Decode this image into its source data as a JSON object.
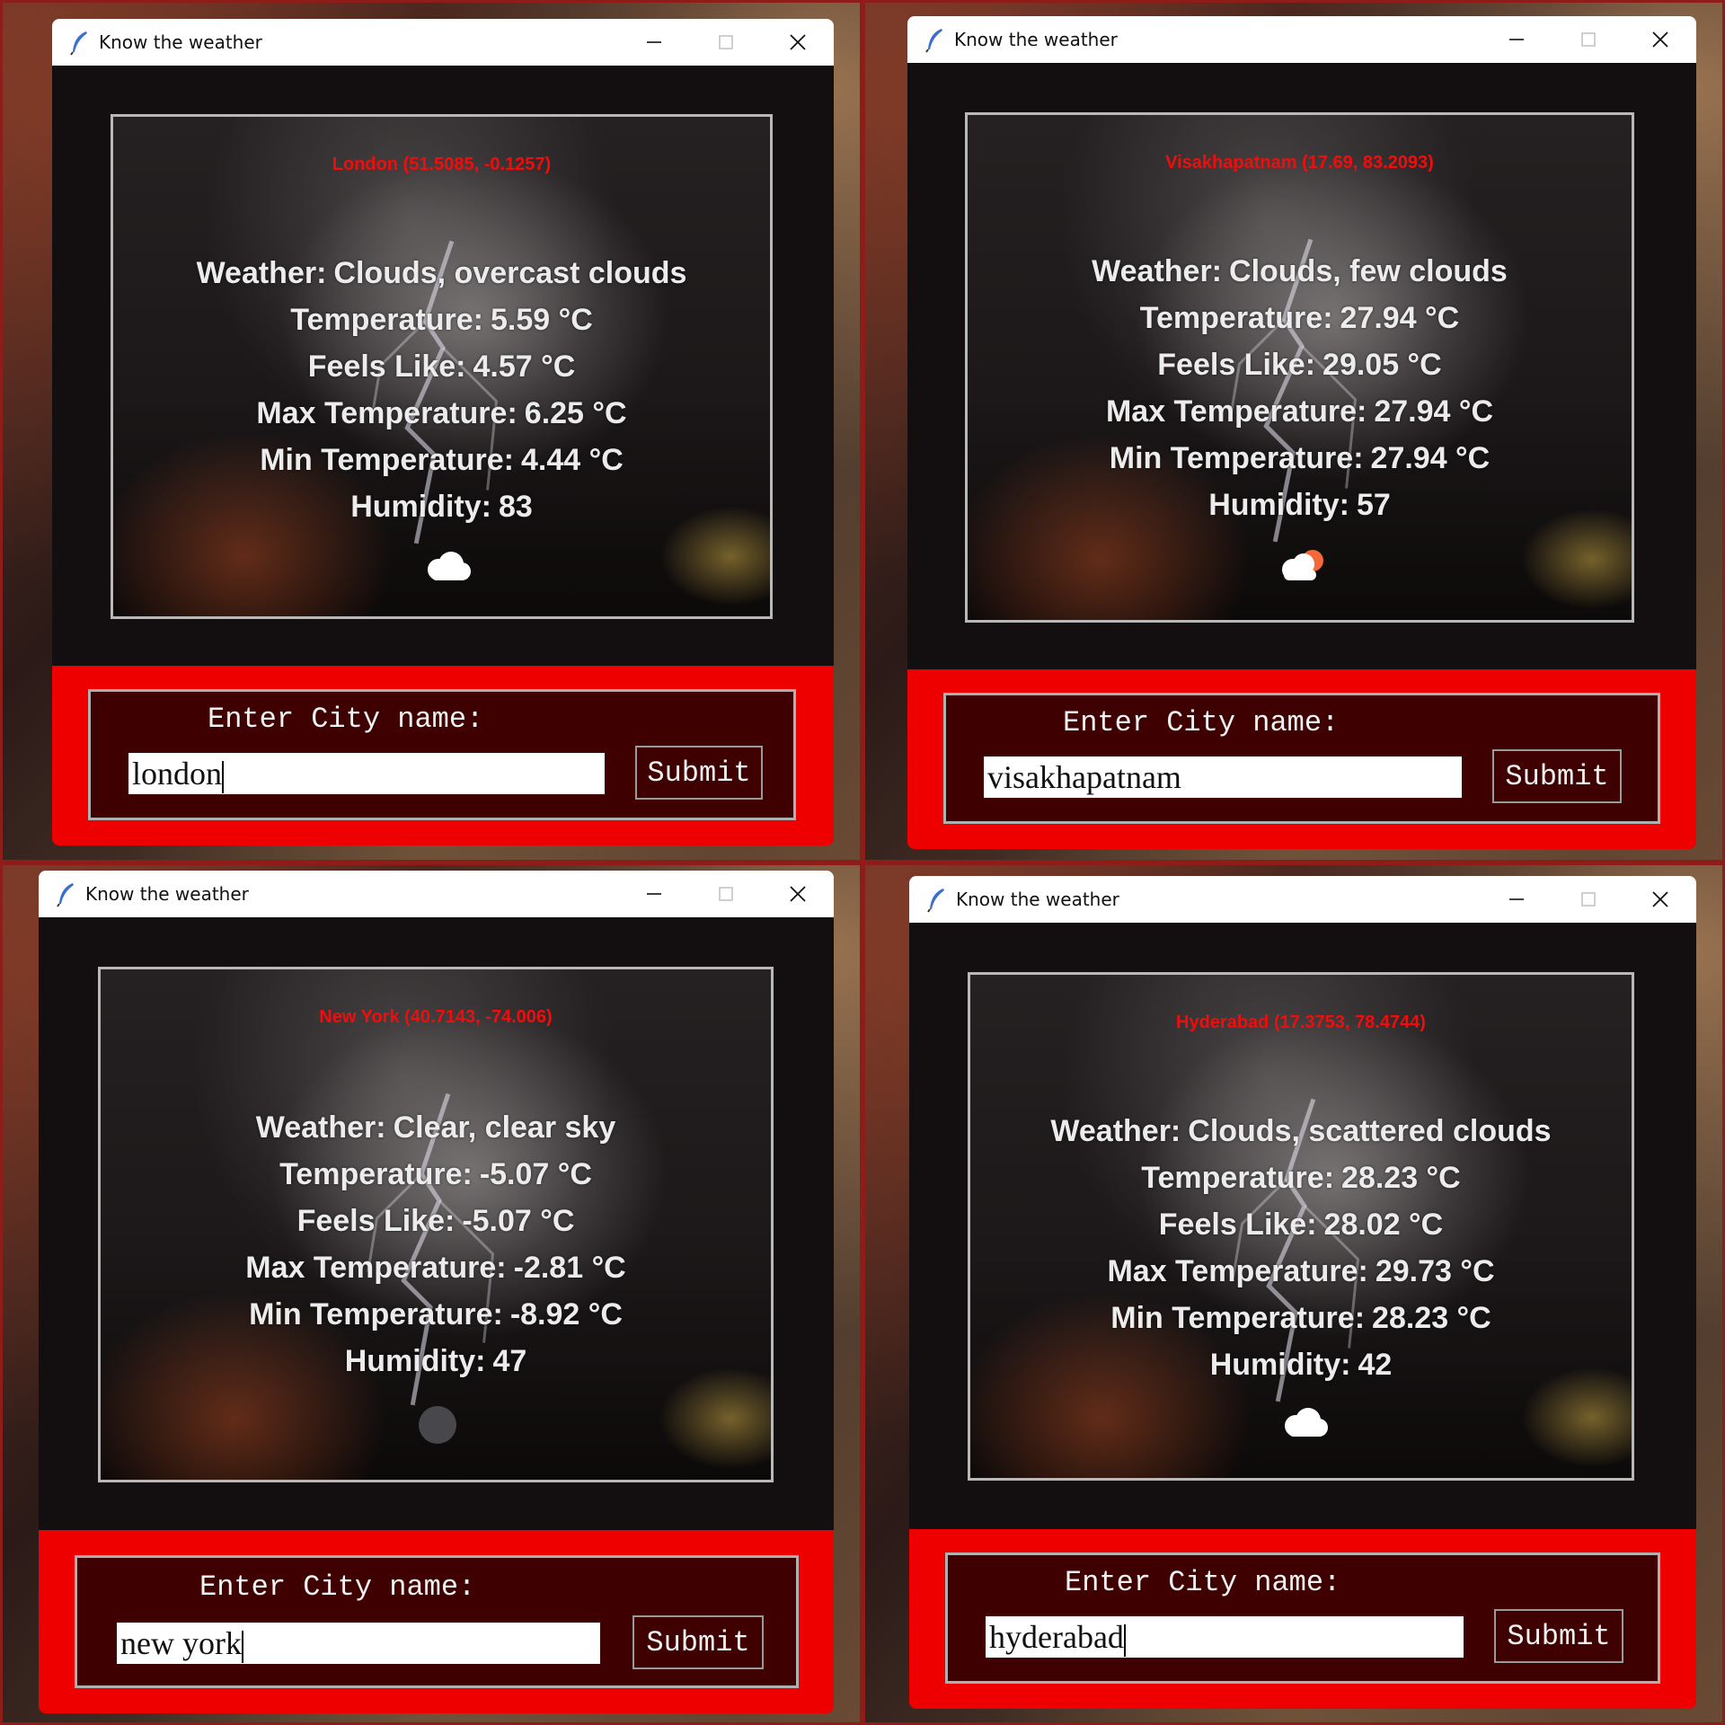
{
  "windows": [
    {
      "title": "Know the weather",
      "city_heading": "London (51.5085, -0.1257)",
      "weather": {
        "label": "Weather:",
        "value": "Clouds, overcast clouds"
      },
      "temperature": {
        "label": "Temperature:",
        "value": "5.59 °C"
      },
      "feels_like": {
        "label": "Feels Like:",
        "value": "4.57 °C"
      },
      "max_temp": {
        "label": "Max Temperature:",
        "value": "6.25 °C"
      },
      "min_temp": {
        "label": "Min Temperature:",
        "value": "4.44 °C"
      },
      "humidity": {
        "label": "Humidity:",
        "value": "83"
      },
      "icon": "cloud-icon",
      "form_label": "Enter City name:",
      "input_value": "london",
      "submit_label": "Submit"
    },
    {
      "title": "Know the weather",
      "city_heading": "Visakhapatnam (17.69, 83.2093)",
      "weather": {
        "label": "Weather:",
        "value": "Clouds, few clouds"
      },
      "temperature": {
        "label": "Temperature:",
        "value": "27.94 °C"
      },
      "feels_like": {
        "label": "Feels Like:",
        "value": "29.05 °C"
      },
      "max_temp": {
        "label": "Max Temperature:",
        "value": "27.94 °C"
      },
      "min_temp": {
        "label": "Min Temperature:",
        "value": "27.94 °C"
      },
      "humidity": {
        "label": "Humidity:",
        "value": "57"
      },
      "icon": "sun-cloud-icon",
      "form_label": "Enter City name:",
      "input_value": "visakhapatnam",
      "submit_label": "Submit"
    },
    {
      "title": "Know the weather",
      "city_heading": "New York (40.7143, -74.006)",
      "weather": {
        "label": "Weather:",
        "value": "Clear, clear sky"
      },
      "temperature": {
        "label": "Temperature:",
        "value": "-5.07 °C"
      },
      "feels_like": {
        "label": "Feels Like:",
        "value": "-5.07 °C"
      },
      "max_temp": {
        "label": "Max Temperature:",
        "value": "-2.81 °C"
      },
      "min_temp": {
        "label": "Min Temperature:",
        "value": "-8.92 °C"
      },
      "humidity": {
        "label": "Humidity:",
        "value": "47"
      },
      "icon": "moon-icon",
      "form_label": "Enter City name:",
      "input_value": "new york",
      "submit_label": "Submit"
    },
    {
      "title": "Know the weather",
      "city_heading": "Hyderabad (17.3753, 78.4744)",
      "weather": {
        "label": "Weather:",
        "value": "Clouds, scattered clouds"
      },
      "temperature": {
        "label": "Temperature:",
        "value": "28.23 °C"
      },
      "feels_like": {
        "label": "Feels Like:",
        "value": "28.02 °C"
      },
      "max_temp": {
        "label": "Max Temperature:",
        "value": "29.73 °C"
      },
      "min_temp": {
        "label": "Min Temperature:",
        "value": "28.23 °C"
      },
      "humidity": {
        "label": "Humidity:",
        "value": "42"
      },
      "icon": "cloud-icon",
      "form_label": "Enter City name:",
      "input_value": "hyderabad",
      "submit_label": "Submit"
    }
  ]
}
